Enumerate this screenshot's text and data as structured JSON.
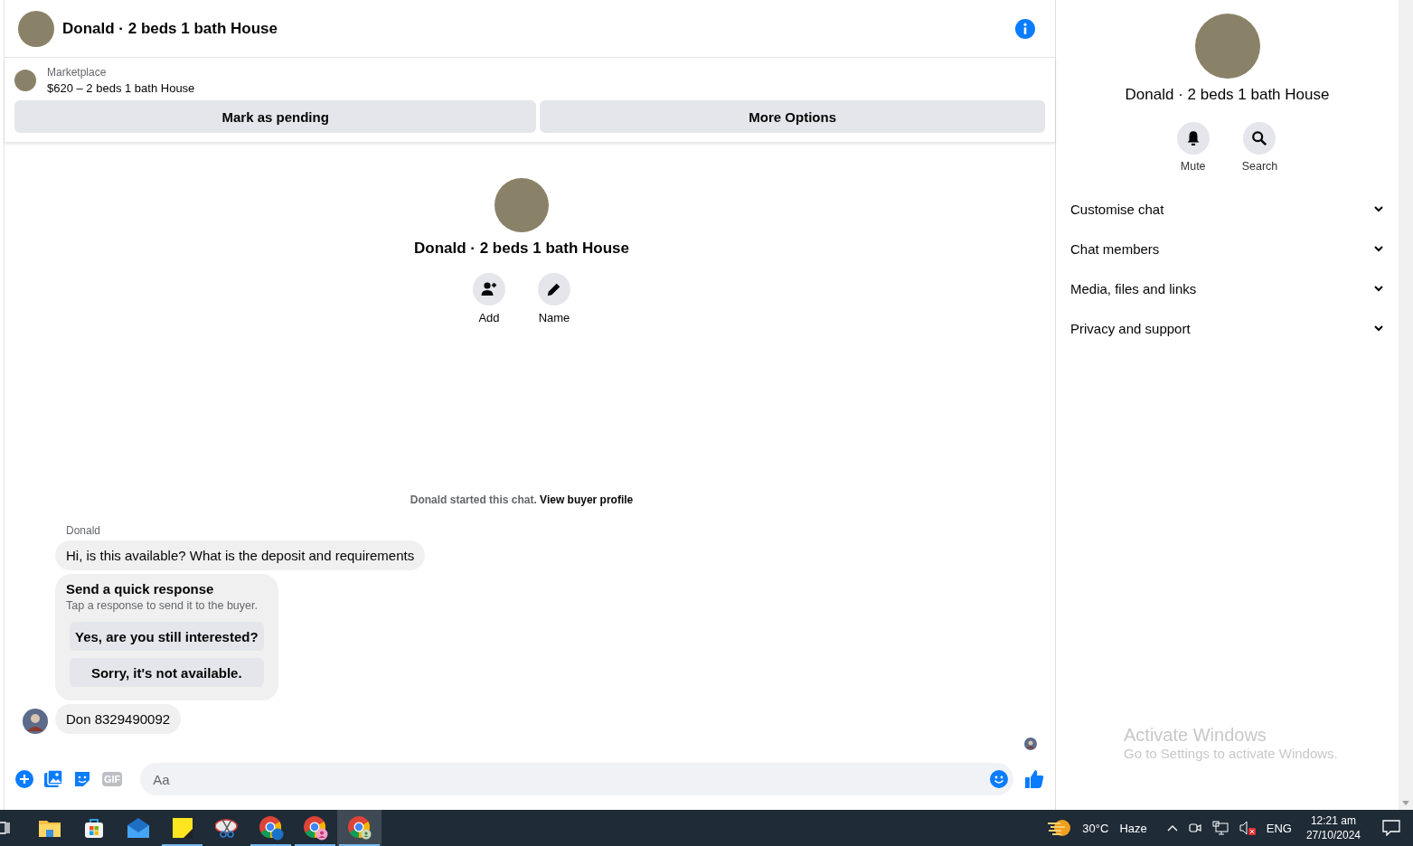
{
  "header": {
    "title": "Donald · 2 beds 1 bath House"
  },
  "listing": {
    "source": "Marketplace",
    "summary": "$620 – 2 beds 1 bath House",
    "buttons": [
      "Mark as pending",
      "More Options"
    ]
  },
  "intro": {
    "title": "Donald · 2 beds 1 bath House",
    "actions": [
      {
        "kind": "add",
        "label": "Add"
      },
      {
        "kind": "name",
        "label": "Name"
      }
    ],
    "notice": "Donald started this chat.",
    "notice_link": "View buyer profile"
  },
  "messages": [
    {
      "kind": "sender",
      "text": "Donald"
    },
    {
      "kind": "bubble",
      "text": "Hi, is this available? What is the deposit and requirements",
      "avatar": false
    },
    {
      "kind": "quick",
      "title": "Send a quick response",
      "hint": "Tap a response to send it to the buyer.",
      "options": [
        "Yes, are you still interested?",
        "Sorry, it's not available."
      ]
    },
    {
      "kind": "bubble",
      "text": "Don 8329490092",
      "avatar": true
    }
  ],
  "composer": {
    "placeholder": "Aa",
    "gif_label": "GIF"
  },
  "details": {
    "title": "Donald · 2 beds 1 bath House",
    "actions": [
      {
        "kind": "mute",
        "label": "Mute"
      },
      {
        "kind": "search",
        "label": "Search"
      }
    ],
    "sections": [
      {
        "label": "Customise chat",
        "expanded": false
      },
      {
        "label": "Chat members",
        "expanded": false
      },
      {
        "label": "Media, files and links",
        "expanded": false
      },
      {
        "label": "Privacy and support",
        "expanded": false
      }
    ]
  },
  "activation_notice": {
    "title": "Activate Windows",
    "text": "Go to Settings to activate Windows."
  },
  "taskbar": {
    "apps": [
      {
        "kind": "folder",
        "running": false,
        "selected": false
      },
      {
        "kind": "store",
        "running": false,
        "selected": false
      },
      {
        "kind": "mail",
        "running": false,
        "selected": false
      },
      {
        "kind": "notes",
        "running": true,
        "selected": false
      },
      {
        "kind": "snip",
        "running": false,
        "selected": false
      },
      {
        "kind": "browser-pc",
        "running": true,
        "selected": false
      },
      {
        "kind": "browser-person",
        "running": true,
        "selected": false
      },
      {
        "kind": "browser-green",
        "running": true,
        "selected": true
      }
    ],
    "weather": {
      "temperature": "30°C",
      "condition": "Haze"
    },
    "language": "ENG",
    "time": "12:21 am",
    "date": "27/10/2024"
  }
}
